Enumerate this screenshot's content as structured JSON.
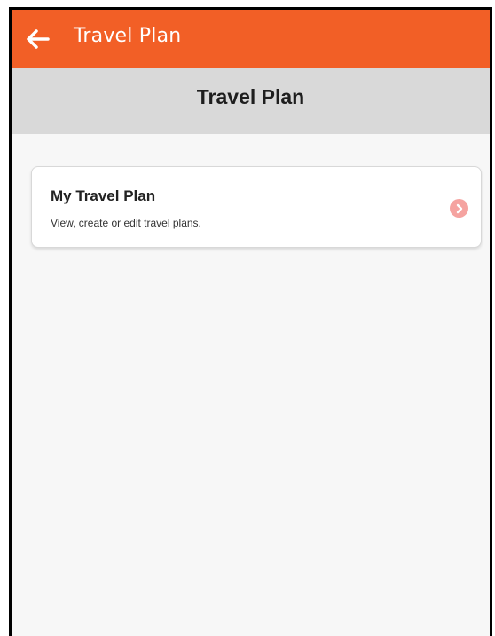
{
  "app_bar": {
    "title": "Travel Plan",
    "back_icon": "arrow-left-icon",
    "color": "#f25f26"
  },
  "header": {
    "title": "Travel Plan",
    "background": "#d9d9d9"
  },
  "cards": [
    {
      "title": "My Travel Plan",
      "subtitle": "View, create or edit travel plans.",
      "action_icon": "chevron-right-circle-icon",
      "action_color": "#f5a3a0"
    }
  ]
}
